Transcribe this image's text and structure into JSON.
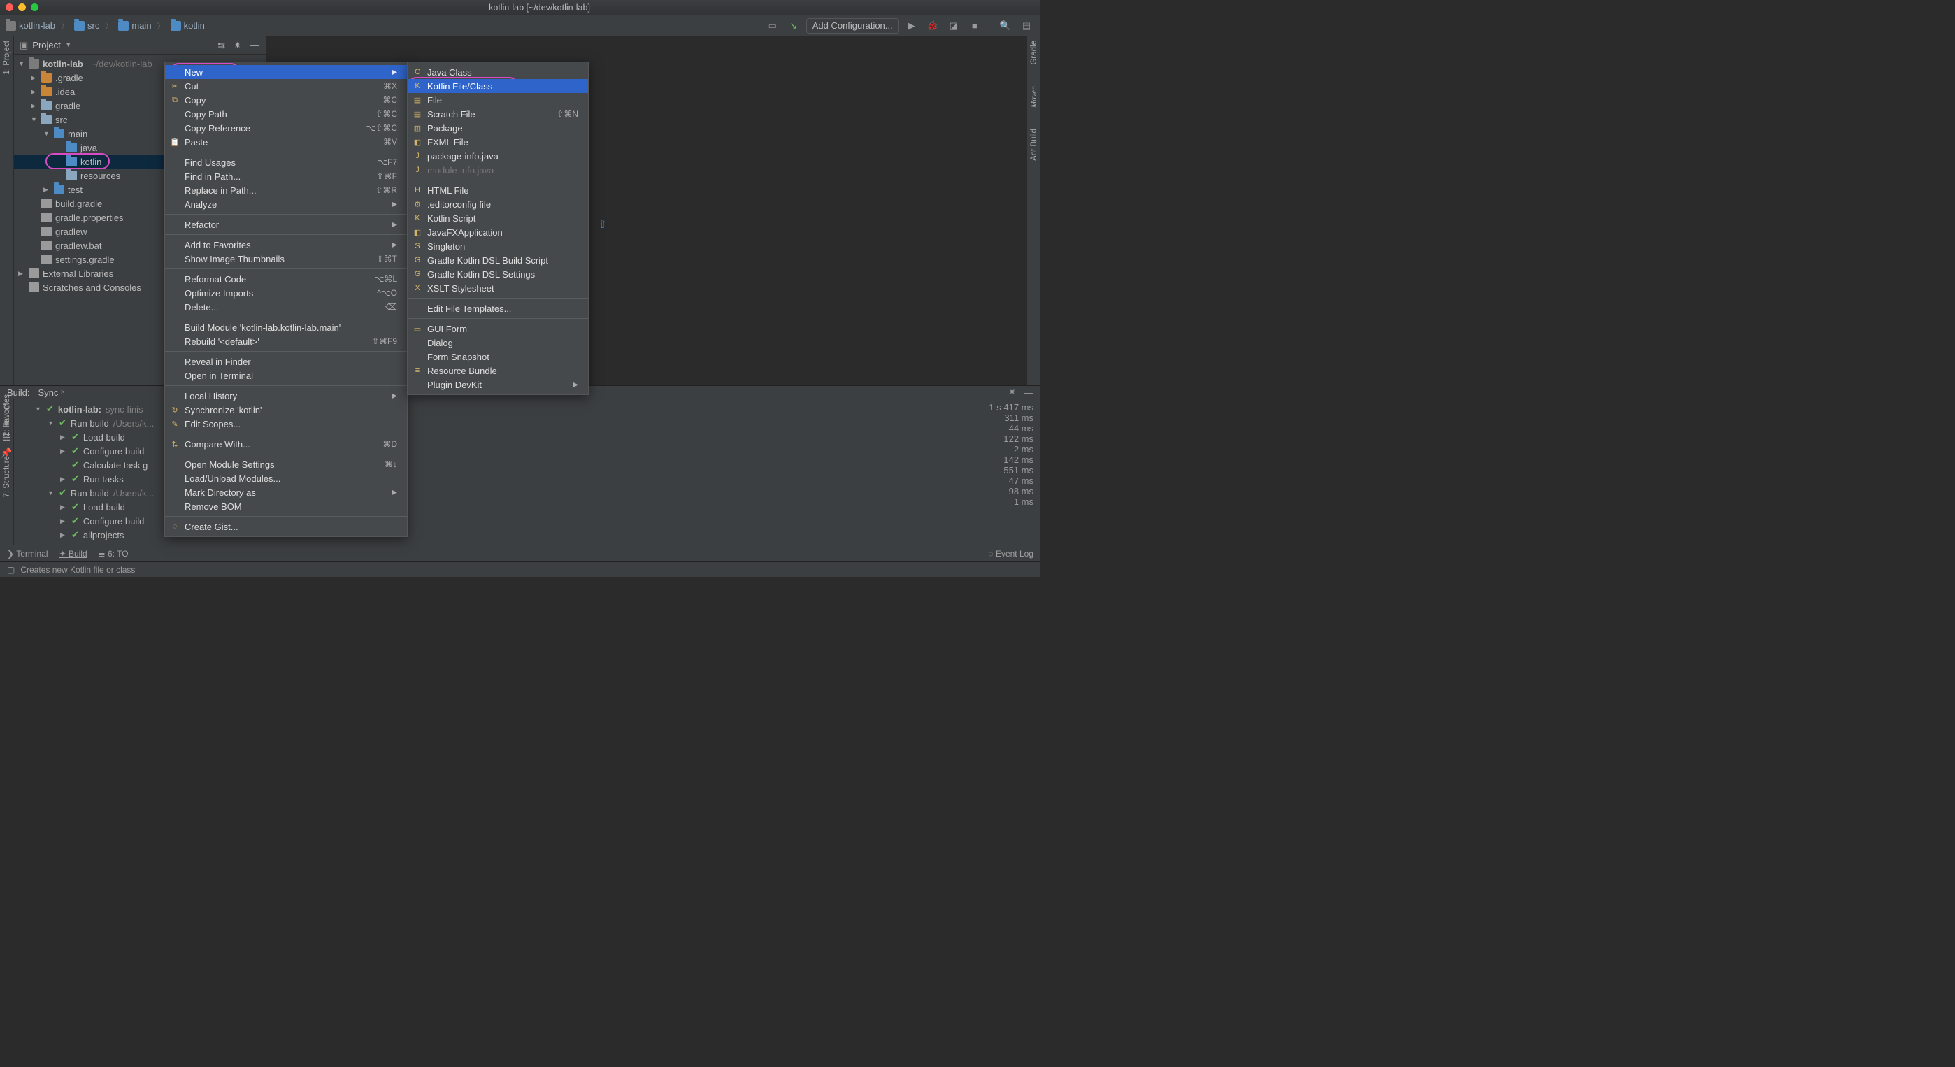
{
  "window": {
    "title": "kotlin-lab [~/dev/kotlin-lab]"
  },
  "breadcrumb": [
    {
      "label": "kotlin-lab"
    },
    {
      "label": "src"
    },
    {
      "label": "main"
    },
    {
      "label": "kotlin"
    }
  ],
  "toolbar": {
    "add_config": "Add Configuration..."
  },
  "project_panel": {
    "title": "Project",
    "tree": {
      "root": {
        "name": "kotlin-lab",
        "path": "~/dev/kotlin-lab"
      },
      "items": [
        ".gradle",
        ".idea",
        "gradle",
        "src",
        "main",
        "java",
        "kotlin",
        "resources",
        "test",
        "build.gradle",
        "gradle.properties",
        "gradlew",
        "gradlew.bat",
        "settings.gradle",
        "External Libraries",
        "Scratches and Consoles"
      ]
    }
  },
  "side_tools": {
    "left": [
      "1: Project",
      "2: Favorites",
      "7: Structure"
    ],
    "right": [
      "Gradle",
      "Maven",
      "Ant Build"
    ]
  },
  "build": {
    "tab_build": "Build:",
    "tab_sync": "Sync",
    "rows": [
      {
        "text": "kotlin-lab:",
        "suffix": " sync finis",
        "time": "1 s 417 ms"
      },
      {
        "text": "Run build",
        "path": "/Users/k...",
        "time": "311 ms"
      },
      {
        "text": "Load build",
        "time": "44 ms"
      },
      {
        "text": "Configure build",
        "time": "122 ms"
      },
      {
        "text": "Calculate task g",
        "time": "2 ms"
      },
      {
        "text": "Run tasks",
        "time": "142 ms"
      },
      {
        "text": "Run build",
        "path": "/Users/k...",
        "time": "551 ms"
      },
      {
        "text": "Load build",
        "time": "47 ms"
      },
      {
        "text": "Configure build",
        "time": "98 ms"
      },
      {
        "text": "allprojects",
        "time": "1 ms"
      }
    ]
  },
  "bottom": {
    "terminal": "Terminal",
    "build": "Build",
    "todo": "6: TO",
    "event_log": "Event Log"
  },
  "status": "Creates new Kotlin file or class",
  "ctx1": {
    "items": [
      {
        "label": "New",
        "sub": true,
        "hl": true
      },
      {
        "label": "Cut",
        "sc": "⌘X",
        "icon": "✂"
      },
      {
        "label": "Copy",
        "sc": "⌘C",
        "icon": "⧉"
      },
      {
        "label": "Copy Path",
        "sc": "⇧⌘C"
      },
      {
        "label": "Copy Reference",
        "sc": "⌥⇧⌘C"
      },
      {
        "label": "Paste",
        "sc": "⌘V",
        "icon": "📋"
      },
      {
        "sep": true
      },
      {
        "label": "Find Usages",
        "sc": "⌥F7"
      },
      {
        "label": "Find in Path...",
        "sc": "⇧⌘F"
      },
      {
        "label": "Replace in Path...",
        "sc": "⇧⌘R"
      },
      {
        "label": "Analyze",
        "sub": true
      },
      {
        "sep": true
      },
      {
        "label": "Refactor",
        "sub": true
      },
      {
        "sep": true
      },
      {
        "label": "Add to Favorites",
        "sub": true
      },
      {
        "label": "Show Image Thumbnails",
        "sc": "⇧⌘T"
      },
      {
        "sep": true
      },
      {
        "label": "Reformat Code",
        "sc": "⌥⌘L"
      },
      {
        "label": "Optimize Imports",
        "sc": "^⌥O"
      },
      {
        "label": "Delete...",
        "sc": "⌫"
      },
      {
        "sep": true
      },
      {
        "label": "Build Module 'kotlin-lab.kotlin-lab.main'"
      },
      {
        "label": "Rebuild '<default>'",
        "sc": "⇧⌘F9"
      },
      {
        "sep": true
      },
      {
        "label": "Reveal in Finder"
      },
      {
        "label": "Open in Terminal"
      },
      {
        "sep": true
      },
      {
        "label": "Local History",
        "sub": true
      },
      {
        "label": "Synchronize 'kotlin'",
        "icon": "↻"
      },
      {
        "label": "Edit Scopes...",
        "icon": "✎"
      },
      {
        "sep": true
      },
      {
        "label": "Compare With...",
        "sc": "⌘D",
        "icon": "⇅"
      },
      {
        "sep": true
      },
      {
        "label": "Open Module Settings",
        "sc": "⌘↓"
      },
      {
        "label": "Load/Unload Modules..."
      },
      {
        "label": "Mark Directory as",
        "sub": true
      },
      {
        "label": "Remove BOM"
      },
      {
        "sep": true
      },
      {
        "label": "Create Gist...",
        "icon": "◌"
      }
    ]
  },
  "ctx2": {
    "items": [
      {
        "label": "Java Class",
        "icon": "C"
      },
      {
        "label": "Kotlin File/Class",
        "hl": true,
        "icon": "K"
      },
      {
        "label": "File",
        "icon": "▤"
      },
      {
        "label": "Scratch File",
        "sc": "⇧⌘N",
        "icon": "▤"
      },
      {
        "label": "Package",
        "icon": "▥"
      },
      {
        "label": "FXML File",
        "icon": "◧"
      },
      {
        "label": "package-info.java",
        "icon": "J"
      },
      {
        "label": "module-info.java",
        "dis": true,
        "icon": "J"
      },
      {
        "sep": true
      },
      {
        "label": "HTML File",
        "icon": "H"
      },
      {
        "label": ".editorconfig file",
        "icon": "⚙"
      },
      {
        "label": "Kotlin Script",
        "icon": "K"
      },
      {
        "label": "JavaFXApplication",
        "icon": "◧"
      },
      {
        "label": "Singleton",
        "icon": "S"
      },
      {
        "label": "Gradle Kotlin DSL Build Script",
        "icon": "G"
      },
      {
        "label": "Gradle Kotlin DSL Settings",
        "icon": "G"
      },
      {
        "label": "XSLT Stylesheet",
        "icon": "X"
      },
      {
        "sep": true
      },
      {
        "label": "Edit File Templates..."
      },
      {
        "sep": true
      },
      {
        "label": "GUI Form",
        "icon": "▭"
      },
      {
        "label": "Dialog"
      },
      {
        "label": "Form Snapshot"
      },
      {
        "label": "Resource Bundle",
        "icon": "≡"
      },
      {
        "label": "Plugin DevKit",
        "sub": true
      }
    ]
  }
}
